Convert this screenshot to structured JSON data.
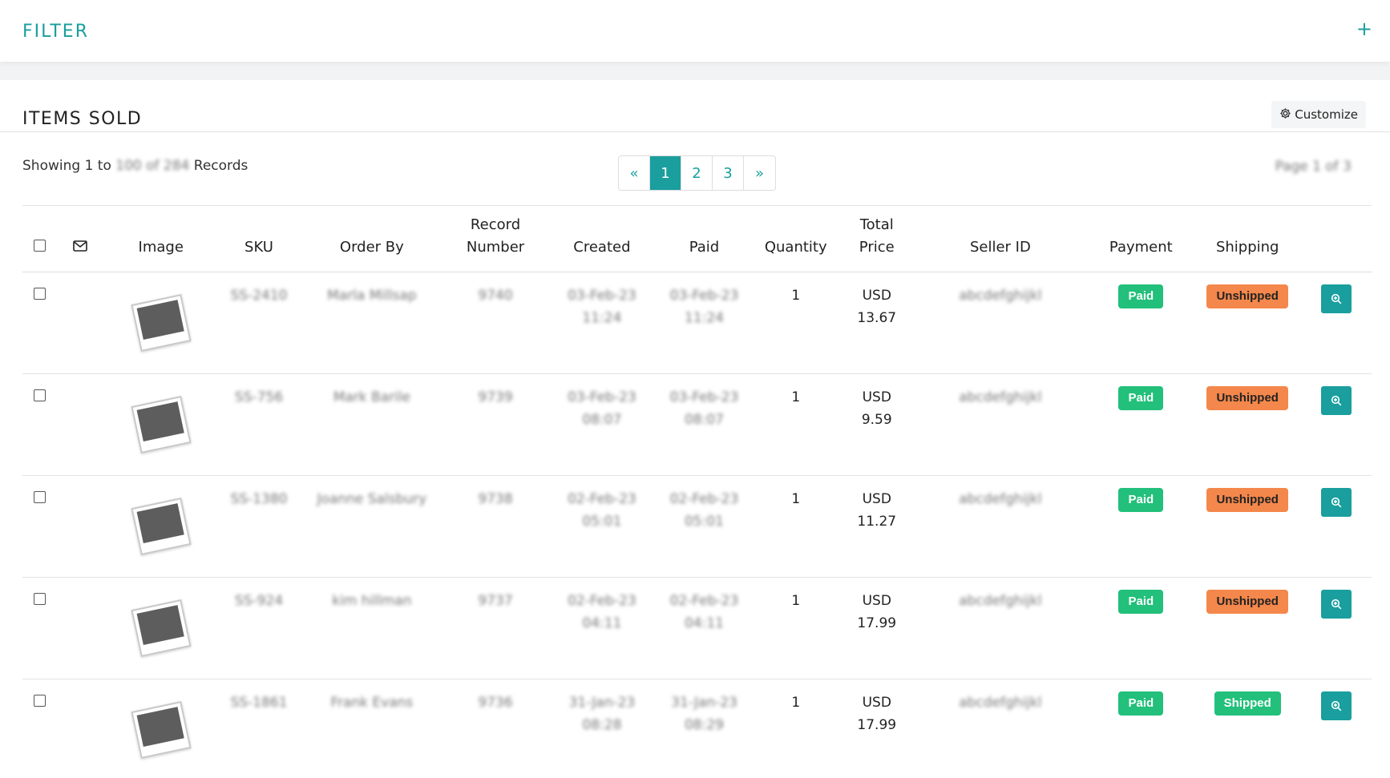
{
  "filter": {
    "title": "FILTER",
    "toggle_icon": "+"
  },
  "items_sold": {
    "title": "ITEMS SOLD",
    "customize_label": "Customize",
    "showing_prefix": "Showing 1 to",
    "showing_range": "100 of 284",
    "showing_suffix": "Records",
    "page_info": "Page 1 of 3",
    "pagination": [
      "«",
      "1",
      "2",
      "3",
      "»"
    ],
    "active_page": "1",
    "columns": {
      "image": "Image",
      "sku": "SKU",
      "order_by": "Order By",
      "record_number_1": "Record",
      "record_number_2": "Number",
      "created": "Created",
      "paid": "Paid",
      "quantity": "Quantity",
      "total_price_1": "Total",
      "total_price_2": "Price",
      "seller_id": "Seller ID",
      "payment": "Payment",
      "shipping": "Shipping"
    },
    "rows": [
      {
        "sku": "SS-2410",
        "order_by": "Marla Millsap",
        "record": "9740",
        "created_date": "03-Feb-23",
        "created_time": "11:24",
        "paid_date": "03-Feb-23",
        "paid_time": "11:24",
        "quantity": "1",
        "currency": "USD",
        "price": "13.67",
        "seller_id": "abcdefghijkl",
        "payment": "Paid",
        "shipping": "Unshipped"
      },
      {
        "sku": "SS-756",
        "order_by": "Mark Barile",
        "record": "9739",
        "created_date": "03-Feb-23",
        "created_time": "08:07",
        "paid_date": "03-Feb-23",
        "paid_time": "08:07",
        "quantity": "1",
        "currency": "USD",
        "price": "9.59",
        "seller_id": "abcdefghijkl",
        "payment": "Paid",
        "shipping": "Unshipped"
      },
      {
        "sku": "SS-1380",
        "order_by": "Joanne Salsbury",
        "record": "9738",
        "created_date": "02-Feb-23",
        "created_time": "05:01",
        "paid_date": "02-Feb-23",
        "paid_time": "05:01",
        "quantity": "1",
        "currency": "USD",
        "price": "11.27",
        "seller_id": "abcdefghijkl",
        "payment": "Paid",
        "shipping": "Unshipped"
      },
      {
        "sku": "SS-924",
        "order_by": "kim hillman",
        "record": "9737",
        "created_date": "02-Feb-23",
        "created_time": "04:11",
        "paid_date": "02-Feb-23",
        "paid_time": "04:11",
        "quantity": "1",
        "currency": "USD",
        "price": "17.99",
        "seller_id": "abcdefghijkl",
        "payment": "Paid",
        "shipping": "Unshipped"
      },
      {
        "sku": "SS-1861",
        "order_by": "Frank Evans",
        "record": "9736",
        "created_date": "31-Jan-23",
        "created_time": "08:28",
        "paid_date": "31-Jan-23",
        "paid_time": "08:29",
        "quantity": "1",
        "currency": "USD",
        "price": "17.99",
        "seller_id": "abcdefghijkl",
        "payment": "Paid",
        "shipping": "Shipped"
      }
    ]
  },
  "colors": {
    "accent": "#1a9e9e",
    "paid": "#22c07a",
    "unshipped": "#f4874b",
    "shipped": "#22c07a"
  }
}
